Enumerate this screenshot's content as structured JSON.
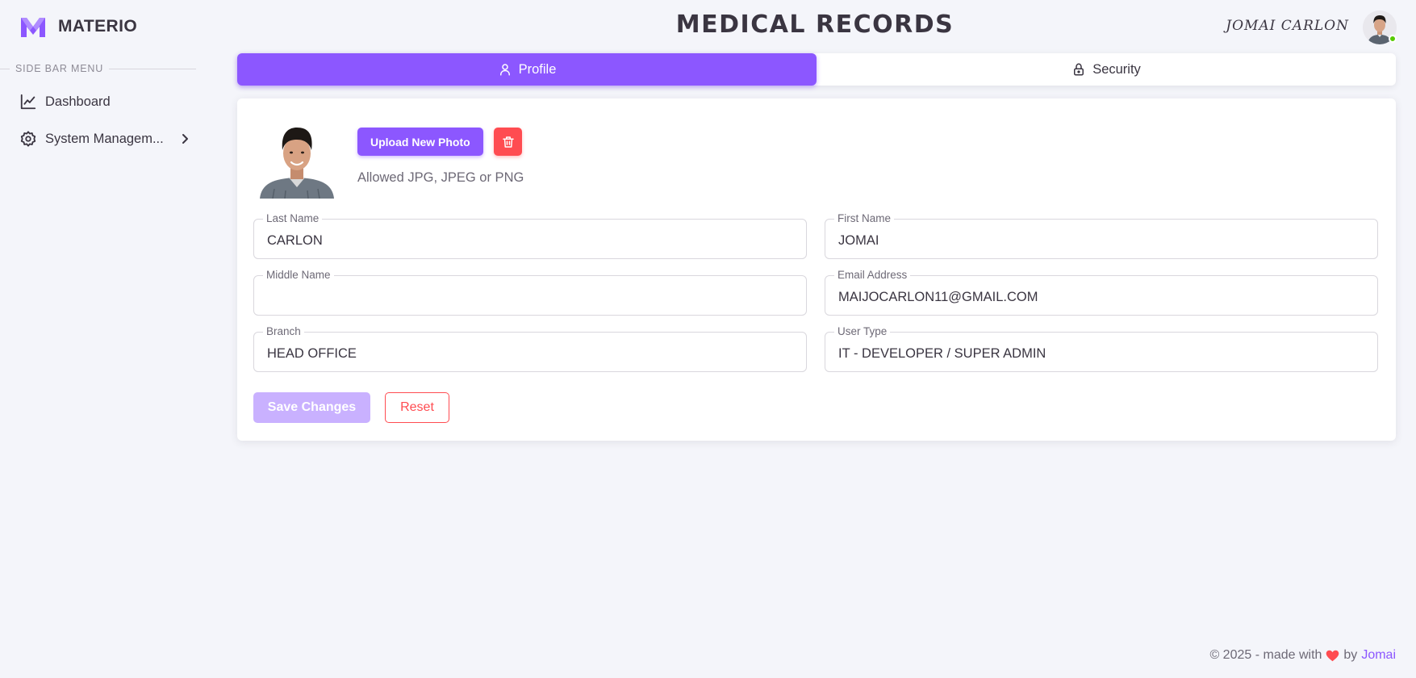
{
  "brand": {
    "name": "MATERIO",
    "logo_icon": "materio-m-logo",
    "color": "#8c57ff"
  },
  "sidebar": {
    "section_label": "SIDE BAR MENU",
    "items": [
      {
        "label": "Dashboard",
        "icon": "chart-line-icon"
      },
      {
        "label": "System Managem...",
        "icon": "gear-icon",
        "has_submenu": true
      }
    ]
  },
  "header": {
    "title": "MEDICAL RECORDS",
    "user_name": "JOMAI CARLON",
    "status": "online",
    "status_color": "#56ca00"
  },
  "tabs": [
    {
      "label": "Profile",
      "icon": "user-icon",
      "active": true
    },
    {
      "label": "Security",
      "icon": "lock-icon",
      "active": false
    }
  ],
  "profile": {
    "upload_label": "Upload New Photo",
    "delete_icon": "trash-icon",
    "allowed_text": "Allowed JPG, JPEG or PNG",
    "fields": {
      "last_name": {
        "label": "Last Name",
        "value": "CARLON"
      },
      "first_name": {
        "label": "First Name",
        "value": "JOMAI"
      },
      "middle_name": {
        "label": "Middle Name",
        "value": ""
      },
      "email": {
        "label": "Email Address",
        "value": "MAIJOCARLON11@GMAIL.COM"
      },
      "branch": {
        "label": "Branch",
        "value": "HEAD OFFICE"
      },
      "user_type": {
        "label": "User Type",
        "value": "IT - DEVELOPER / SUPER ADMIN"
      }
    },
    "save_label": "Save Changes",
    "reset_label": "Reset"
  },
  "footer": {
    "prefix": "© 2025 - made with",
    "heart_icon": "heart-icon",
    "by": "by",
    "author": "Jomai"
  },
  "colors": {
    "primary": "#8c57ff",
    "primary_disabled": "#c9b1ff",
    "danger": "#ff4c51",
    "background": "#f4f5fa",
    "text": "#3a3541"
  }
}
